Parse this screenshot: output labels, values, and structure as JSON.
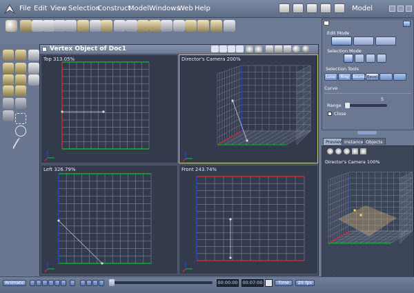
{
  "menubar": {
    "items": [
      "File",
      "Edit",
      "View",
      "Selection",
      "Construct",
      "Model",
      "Windows",
      "Web",
      "Help"
    ],
    "room": "Model"
  },
  "viewport": {
    "title": "Vertex Object of Doc1",
    "panes": [
      {
        "label": "Top 313.05%"
      },
      {
        "label": "Director's Camera 200%"
      },
      {
        "label": "Left 326.79%"
      },
      {
        "label": "Front 243.74%"
      }
    ]
  },
  "right_panel": {
    "edit_mode": "Edit Mode",
    "selection_mode": "Selection Mode",
    "selection_tools": "Selection Tools",
    "tools": [
      "Loop",
      "Ring",
      "Boundary",
      "Bevel",
      "",
      ""
    ],
    "curve": "Curve",
    "range_label": "Range",
    "range_value": "5",
    "close_label": "Close"
  },
  "preview": {
    "tabs": [
      "Preview",
      "Instances",
      "Objects"
    ],
    "active_tab": "Preview",
    "label": "Director's Camera 100%"
  },
  "timeline": {
    "animate": "Animate",
    "time_start": "00:00:00",
    "time_end": "00:07:00",
    "time_mode": "Time",
    "fps": "25 fps"
  },
  "colors": {
    "accent": "#5b78b5",
    "axis_x": "#00cc22",
    "axis_y": "#ff2222",
    "axis_z": "#2244ff",
    "grid": "#8d97ab"
  }
}
